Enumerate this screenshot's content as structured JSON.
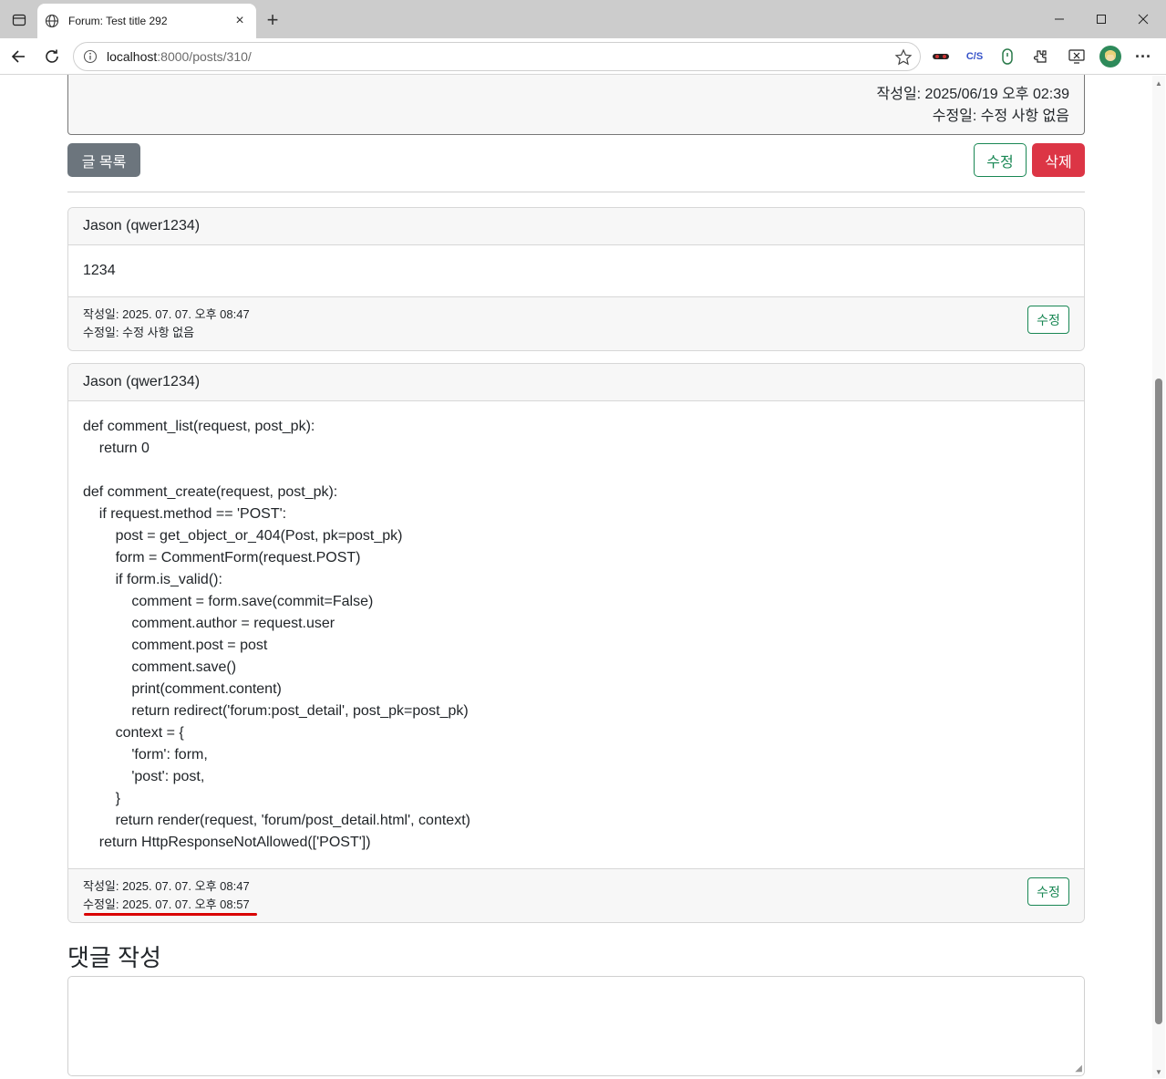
{
  "browser": {
    "tab_title": "Forum: Test title 292",
    "url_host": "localhost",
    "url_path": ":8000/posts/310/"
  },
  "post": {
    "created": "작성일: 2025/06/19 오후 02:39",
    "modified": "수정일: 수정 사항 없음",
    "list_button": "글 목록",
    "edit_button": "수정",
    "delete_button": "삭제"
  },
  "comments": [
    {
      "author": "Jason (qwer1234)",
      "body": [
        "1234"
      ],
      "created": "작성일: 2025. 07. 07. 오후 08:47",
      "modified": "수정일: 수정 사항 없음",
      "edit_button": "수정"
    },
    {
      "author": "Jason (qwer1234)",
      "body": [
        "def comment_list(request, post_pk):",
        "    return 0",
        "",
        "def comment_create(request, post_pk):",
        "    if request.method == 'POST':",
        "        post = get_object_or_404(Post, pk=post_pk)",
        "        form = CommentForm(request.POST)",
        "        if form.is_valid():",
        "            comment = form.save(commit=False)",
        "            comment.author = request.user",
        "            comment.post = post",
        "            comment.save()",
        "            print(comment.content)",
        "            return redirect('forum:post_detail', post_pk=post_pk)",
        "        context = {",
        "            'form': form,",
        "            'post': post,",
        "        }",
        "        return render(request, 'forum/post_detail.html', context)",
        "    return HttpResponseNotAllowed(['POST'])"
      ],
      "created": "작성일: 2025. 07. 07. 오후 08:47",
      "modified": "수정일: 2025. 07. 07. 오후 08:57",
      "edit_button": "수정"
    }
  ],
  "comment_form": {
    "title": "댓글 작성"
  },
  "colors": {
    "edit_green": "#198754",
    "delete_red": "#dc3545",
    "list_gray": "#6c757d",
    "annotation_red": "#d90000"
  },
  "icons": [
    "tab-actions-icon",
    "globe-icon",
    "close-icon",
    "plus-icon",
    "minimize-icon",
    "maximize-icon",
    "window-close-icon",
    "back-icon",
    "reload-icon",
    "info-icon",
    "star-icon",
    "extension-icon",
    "more-icon"
  ]
}
